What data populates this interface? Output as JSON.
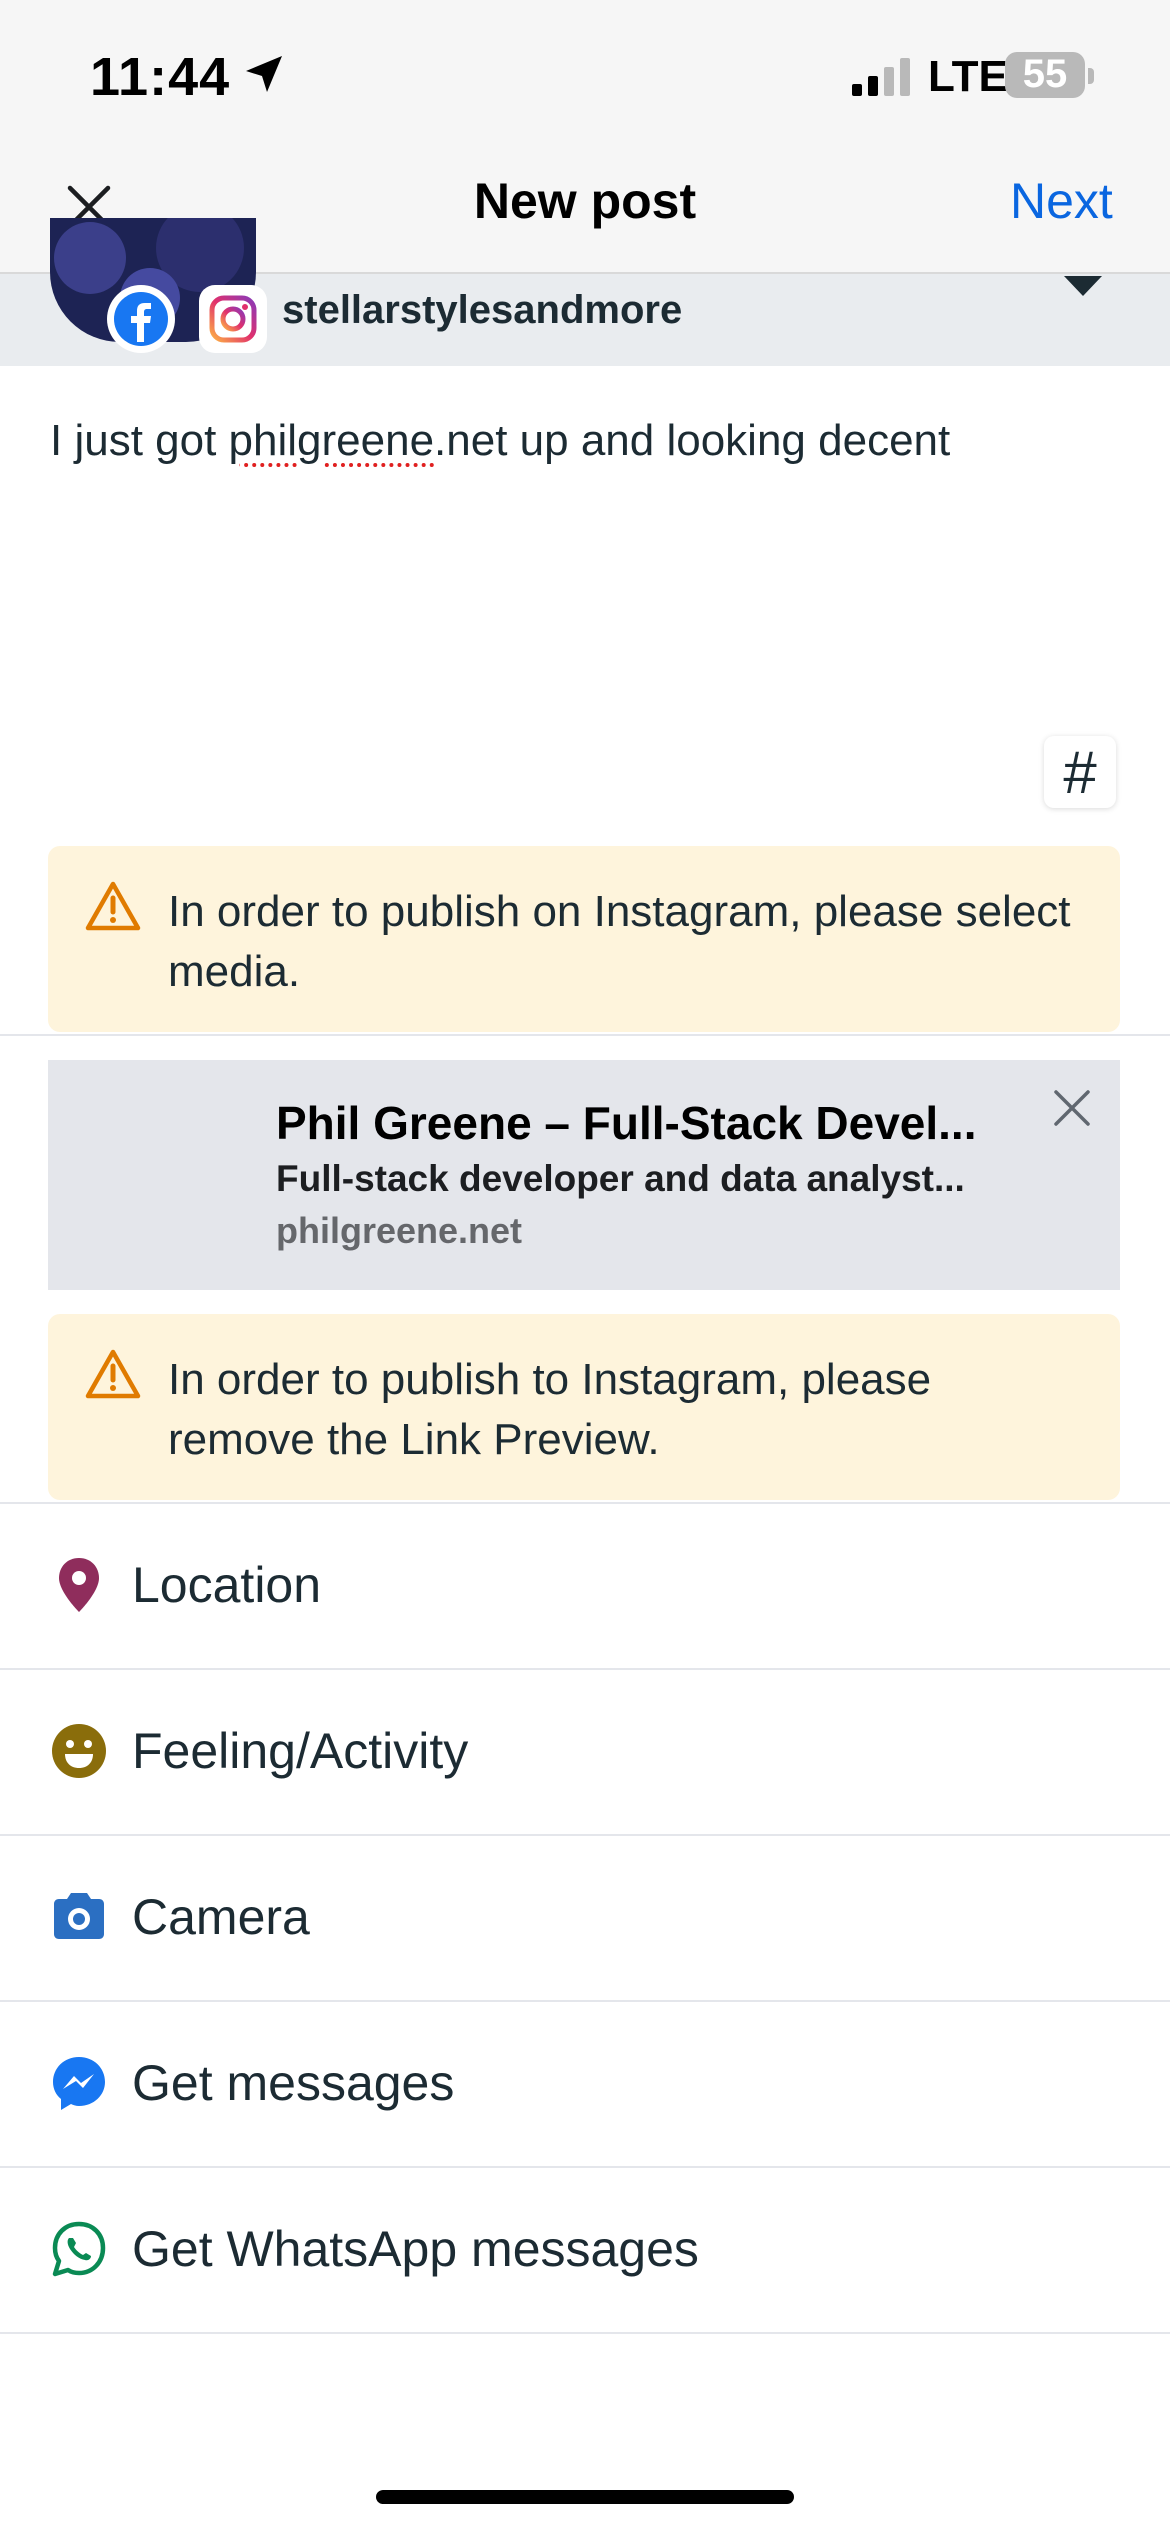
{
  "status_bar": {
    "time": "11:44",
    "network": "LTE",
    "battery": "55"
  },
  "header": {
    "title": "New post",
    "next_label": "Next"
  },
  "account": {
    "name": "stellarstylesandmore"
  },
  "post": {
    "text_before": "I just got ",
    "text_misspelled": "philgreene",
    "text_after": ".net up and looking decent",
    "hashtag_symbol": "#"
  },
  "warnings": [
    {
      "text": "In order to publish on Instagram, please select media."
    },
    {
      "text": "In order to publish to Instagram, please remove the Link Preview."
    }
  ],
  "link_preview": {
    "title": "Phil Greene – Full-Stack Devel...",
    "description": "Full-stack developer and data analyst...",
    "url": "philgreene.net"
  },
  "options": [
    {
      "label": "Location",
      "icon": "location-pin-icon",
      "color": "#8f2d5c"
    },
    {
      "label": "Feeling/Activity",
      "icon": "smiley-icon",
      "color": "#8a6d0b"
    },
    {
      "label": "Camera",
      "icon": "camera-icon",
      "color": "#2b6fc2"
    },
    {
      "label": "Get messages",
      "icon": "messenger-icon",
      "color": "#1877f2"
    },
    {
      "label": "Get WhatsApp messages",
      "icon": "whatsapp-icon",
      "color": "#0a8a54"
    }
  ],
  "colors": {
    "accent": "#0a66e0",
    "warning_bg": "#fef4dc",
    "warning_icon": "#e07b00"
  }
}
